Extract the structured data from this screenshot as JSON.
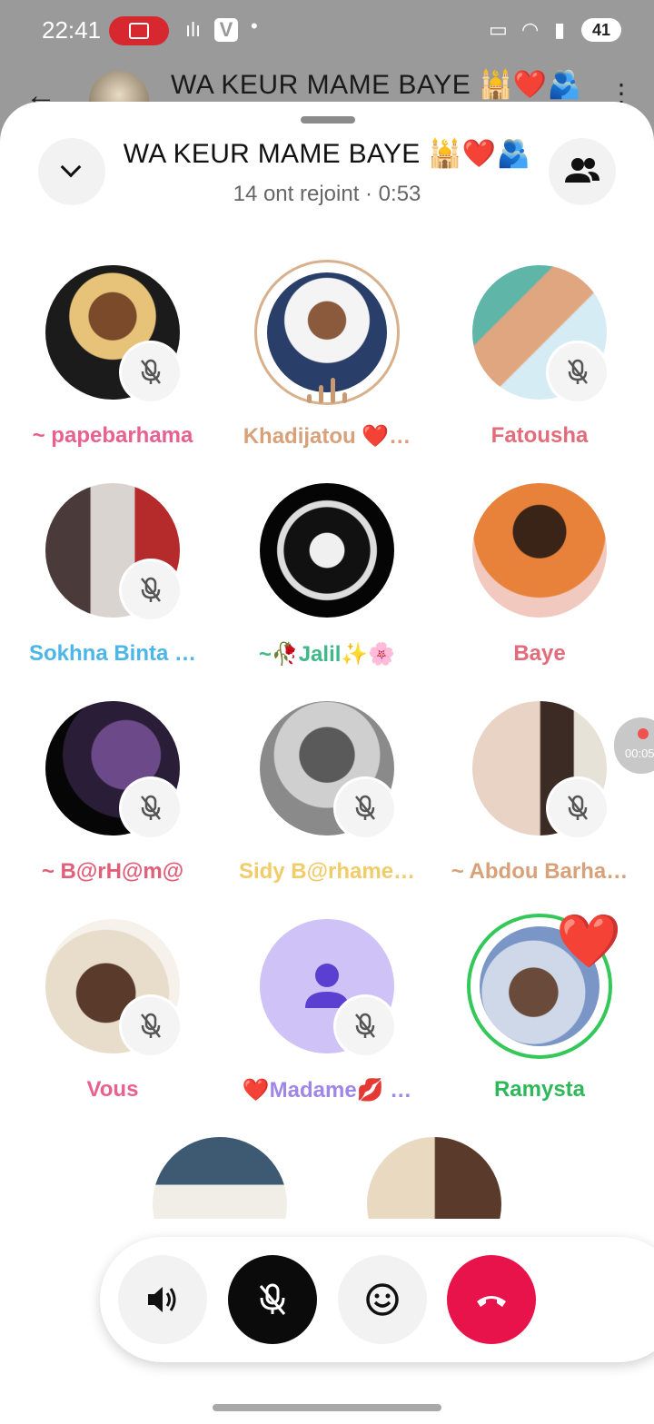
{
  "status_bar": {
    "time": "22:41",
    "battery": "41"
  },
  "chat_header": {
    "title": "WA KEUR MAME BAYE 🕌❤️🫂"
  },
  "call": {
    "title": "WA KEUR MAME BAYE 🕌❤️🫂",
    "subtitle": "14 ont rejoint · 0:53"
  },
  "participants": [
    {
      "name": "~ papebarhama",
      "color": "#e8608f",
      "muted": true
    },
    {
      "name": "Khadijatou ❤️…",
      "color": "#d8a17a",
      "muted": false,
      "speaking": true
    },
    {
      "name": "Fatousha",
      "color": "#e36b7a",
      "muted": true
    },
    {
      "name": "Sokhna Binta …",
      "color": "#4db6e8",
      "muted": true
    },
    {
      "name": "~🥀Jalil✨🌸",
      "color": "#3fb98a",
      "muted": false
    },
    {
      "name": "Baye",
      "color": "#e36b7a",
      "muted": false
    },
    {
      "name": "~ B@rH@m@",
      "color": "#e0607a",
      "muted": true
    },
    {
      "name": "Sidy B@rhame…",
      "color": "#f0cc6a",
      "muted": true
    },
    {
      "name": "~ Abdou Barha…",
      "color": "#d8a17a",
      "muted": true
    },
    {
      "name": "Vous",
      "color": "#e8608f",
      "muted": true
    },
    {
      "name": "❤️Madame💋 …",
      "color": "#9f86e8",
      "muted": true
    },
    {
      "name": "Ramysta",
      "color": "#2fb85a",
      "muted": false,
      "reaction": "❤️"
    }
  ],
  "recording_chip": {
    "time": "00:05"
  },
  "controls": {
    "speaker": "speaker-icon",
    "mic": "mic-off-icon",
    "reaction": "emoji-icon",
    "end": "end-call-icon"
  },
  "colors": {
    "end_call": "#e8134b",
    "speaking_ring": "#d9b08c",
    "active_ring": "#34c759"
  }
}
